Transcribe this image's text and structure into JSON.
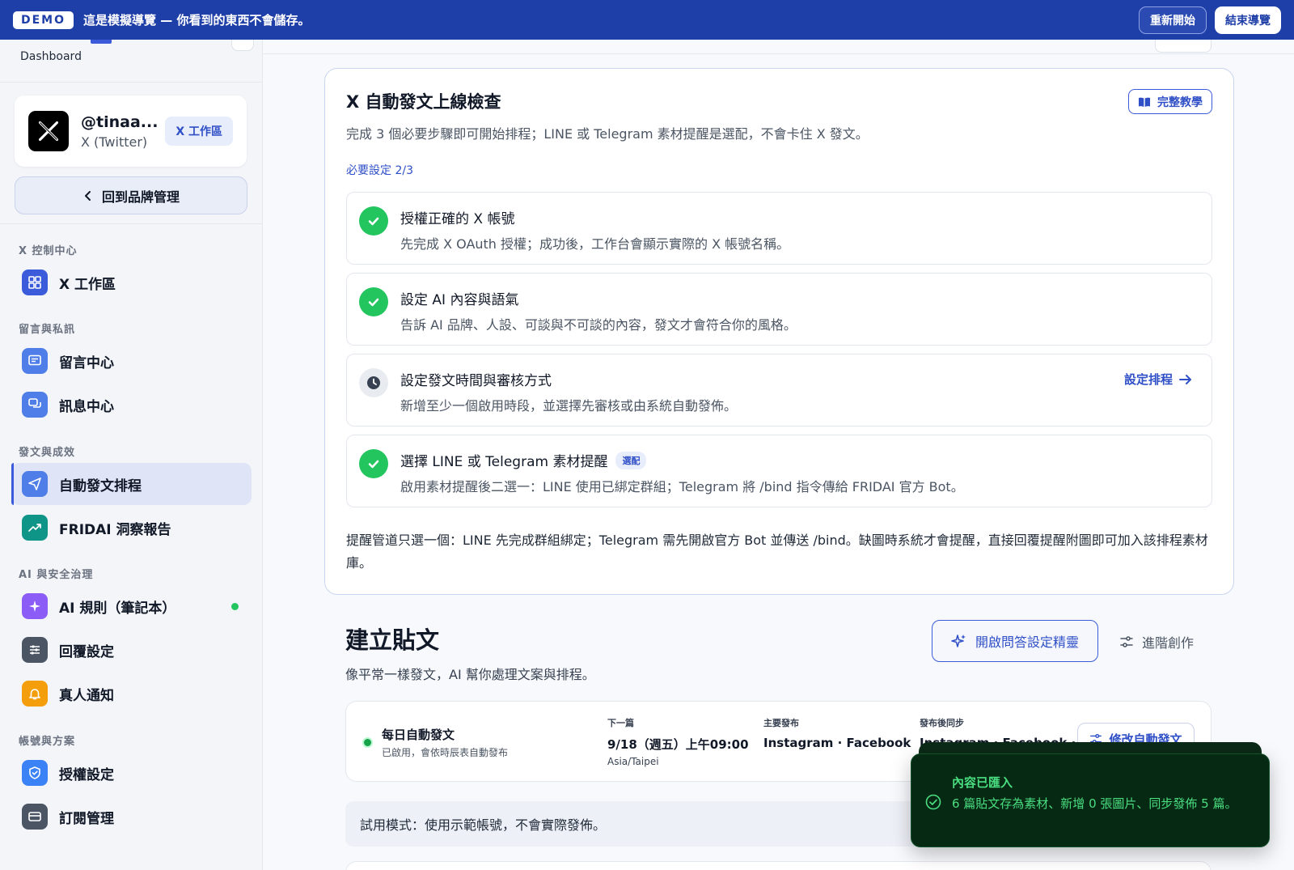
{
  "demo": {
    "badge": "DEMO",
    "message": "這是模擬導覽 — 你看到的東西不會儲存。",
    "restart": "重新開始",
    "end": "結束導覽"
  },
  "sidebar": {
    "dashboard_label": "Dashboard",
    "account": {
      "name": "@tinaa...",
      "platform": "X (Twitter)",
      "workspace_tag": "X 工作區"
    },
    "back_button": "回到品牌管理",
    "sections": [
      {
        "title": "X 控制中心",
        "items": [
          {
            "label": "X 工作區",
            "icon": "grid-icon"
          }
        ]
      },
      {
        "title": "留言與私訊",
        "items": [
          {
            "label": "留言中心",
            "icon": "comment-icon"
          },
          {
            "label": "訊息中心",
            "icon": "chat-icon"
          }
        ]
      },
      {
        "title": "發文與成效",
        "items": [
          {
            "label": "自動發文排程",
            "icon": "send-icon",
            "active": true
          },
          {
            "label": "FRIDAI 洞察報告",
            "icon": "trend-icon"
          }
        ]
      },
      {
        "title": "AI 與安全治理",
        "items": [
          {
            "label": "AI 規則（筆記本）",
            "icon": "sparkle-icon"
          },
          {
            "label": "回覆設定",
            "icon": "sliders-icon"
          },
          {
            "label": "真人通知",
            "icon": "bell-icon"
          }
        ]
      },
      {
        "title": "帳號與方案",
        "items": [
          {
            "label": "授權設定",
            "icon": "shield-icon"
          },
          {
            "label": "訂閱管理",
            "icon": "card-icon"
          }
        ]
      }
    ]
  },
  "checklist": {
    "title": "X 自動發文上線檢查",
    "subtitle": "完成 3 個必要步驟即可開始排程；LINE 或 Telegram 素材提醒是選配，不會卡住 X 發文。",
    "progress": "必要設定 2/3",
    "tutorial_button": "完整教學",
    "steps": [
      {
        "title": "授權正確的 X 帳號",
        "desc": "先完成 X OAuth 授權；成功後，工作台會顯示實際的 X 帳號名稱。",
        "status": "done"
      },
      {
        "title": "設定 AI 內容與語氣",
        "desc": "告訴 AI 品牌、人設、可談與不可談的內容，發文才會符合你的風格。",
        "status": "done"
      },
      {
        "title": "設定發文時間與審核方式",
        "desc": "新增至少一個啟用時段，並選擇先審核或由系統自動發佈。",
        "status": "pending",
        "action": "設定排程"
      },
      {
        "title": "選擇 LINE 或 Telegram 素材提醒",
        "desc": "啟用素材提醒後二選一：LINE 使用已綁定群組；Telegram 將 /bind 指令傳給 FRIDAI 官方 Bot。",
        "status": "done",
        "badge": "選配"
      }
    ],
    "note": "提醒管道只選一個：LINE 先完成群組綁定；Telegram 需先開啟官方 Bot 並傳送 /bind。缺圖時系統才會提醒，直接回覆提醒附圖即可加入該排程素材庫。"
  },
  "create": {
    "title": "建立貼文",
    "subtitle": "像平常一樣發文，AI 幫你處理文案與排程。",
    "wizard_button": "開啟問答設定精靈",
    "advanced_button": "進階創作"
  },
  "auto_post": {
    "title": "每日自動發文",
    "desc": "已啟用，會依時辰表自動發布",
    "next_label": "下一篇",
    "next_value": "9/18（週五）上午09:00",
    "timezone": "Asia/Taipei",
    "primary_label": "主要發布",
    "primary_value": "Instagram · Facebook",
    "sync_label": "發布後同步",
    "sync_value": "Instagram · Facebook ·",
    "edit_button": "修改自動發文"
  },
  "trial_notice": "試用模式：使用示範帳號，不會實際發佈。",
  "toast": {
    "title": "內容已匯入",
    "body": "6 篇貼文存為素材、新增 0 張圖片、同步發佈 5 篇。"
  },
  "colors": {
    "brand": "#1f3fa8",
    "accent": "#3b5bdb",
    "success": "#22c55e",
    "toast_bg": "#062914"
  }
}
